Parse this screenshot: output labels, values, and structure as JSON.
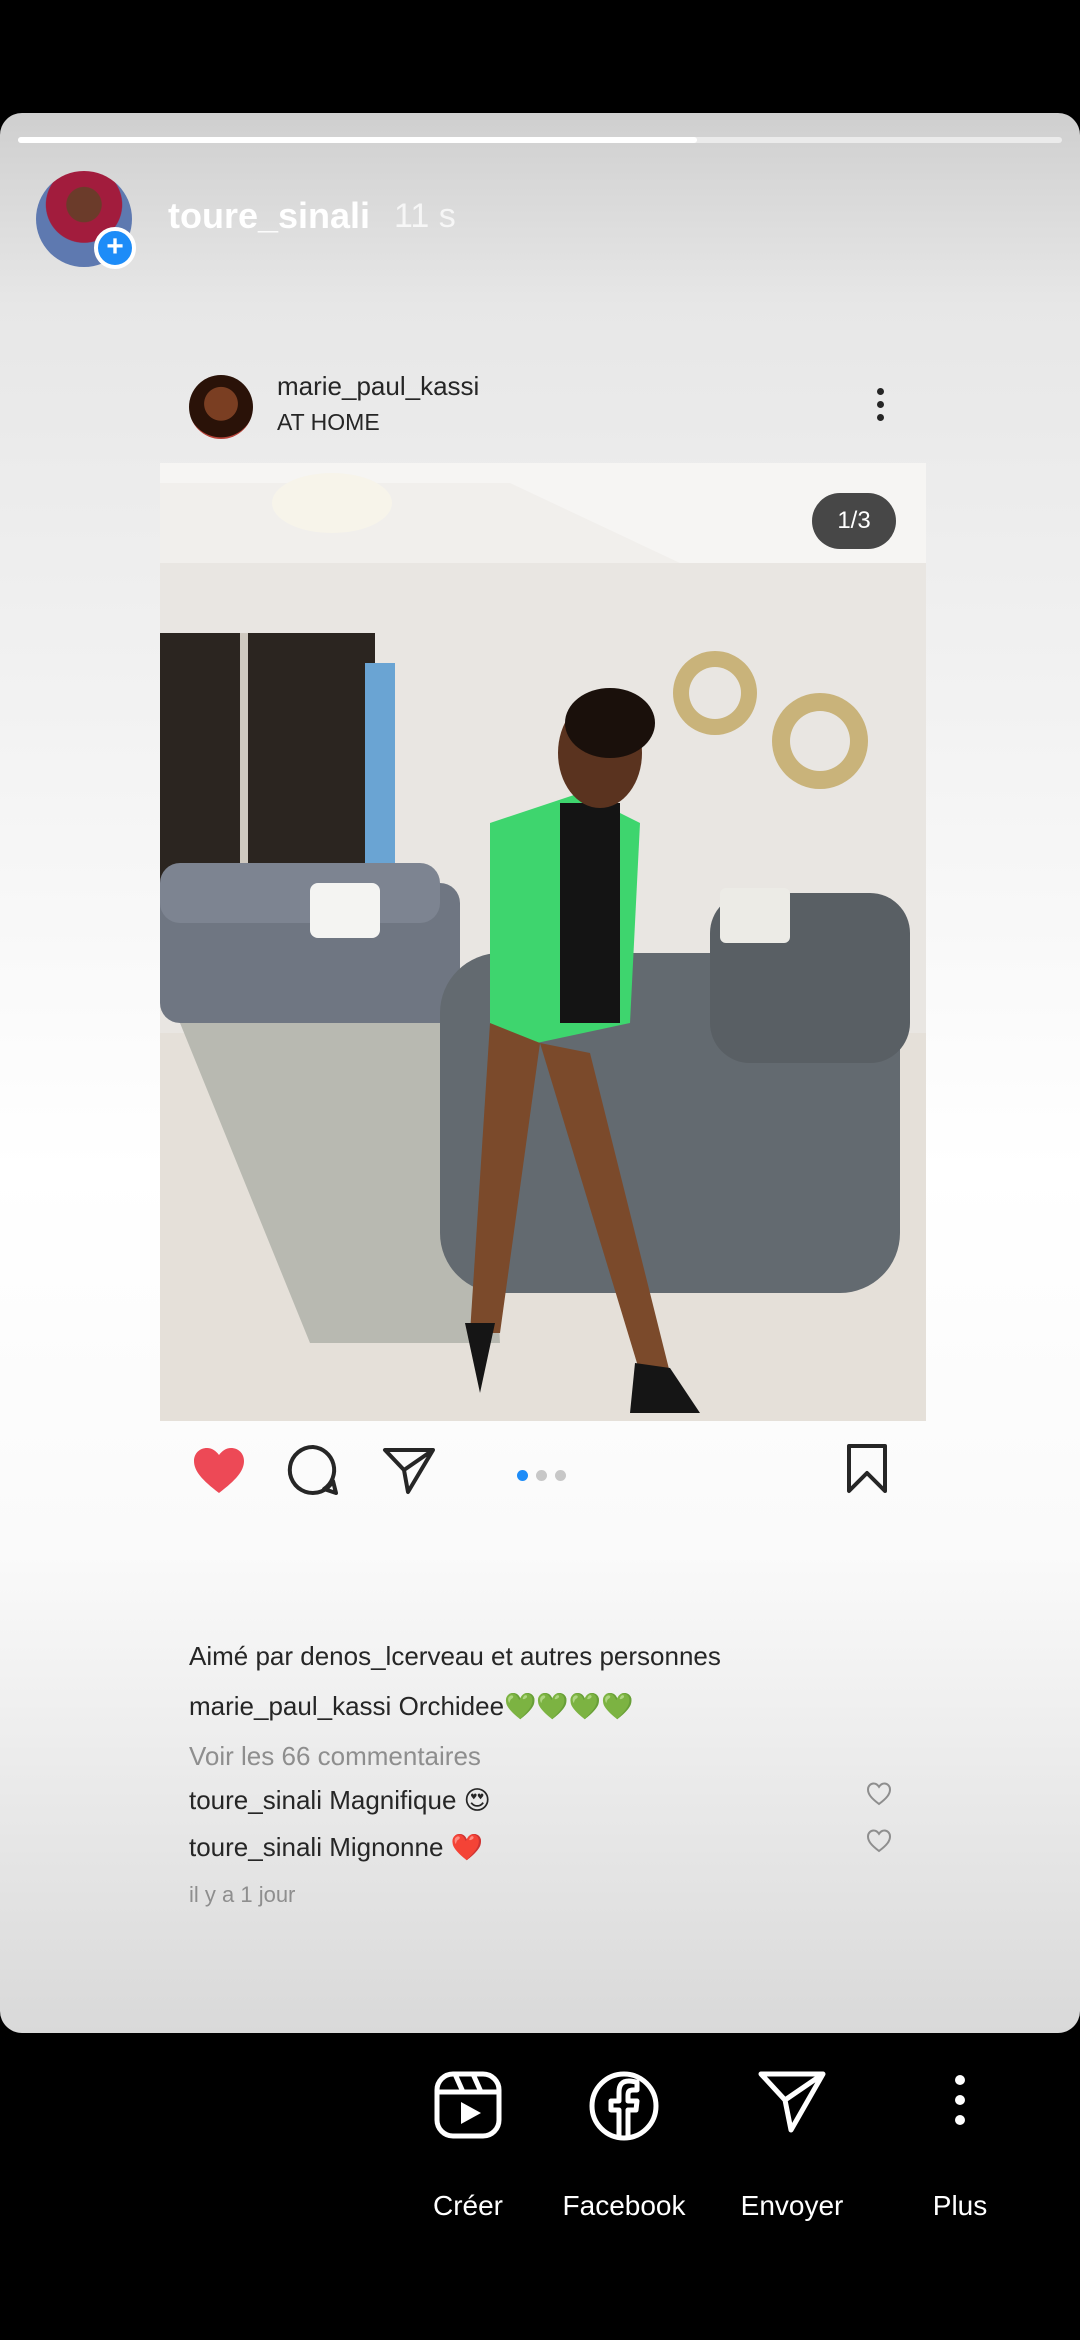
{
  "story": {
    "username": "toure_sinali",
    "time": "11 s",
    "progress_fraction": 0.65
  },
  "post": {
    "username": "marie_paul_kassi",
    "location": "AT HOME",
    "page_indicator": "1/3",
    "carousel_pages": 3,
    "carousel_active": 1,
    "likes_text": "Aimé par denos_lcerveau et autres personnes",
    "caption_user": "marie_paul_kassi",
    "caption_text": "Orchidee💚💚💚💚",
    "view_comments": "Voir les 66 commentaires",
    "comments": [
      {
        "user": "toure_sinali",
        "text": "Magnifique 😍"
      },
      {
        "user": "toure_sinali",
        "text": "Mignonne ❤️"
      }
    ],
    "date": "il y a 1 jour",
    "liked": true
  },
  "bottom_bar": {
    "items": [
      {
        "label": "Créer",
        "icon": "reels-icon"
      },
      {
        "label": "Facebook",
        "icon": "facebook-icon"
      },
      {
        "label": "Envoyer",
        "icon": "send-icon"
      },
      {
        "label": "Plus",
        "icon": "more-vertical-icon"
      }
    ]
  },
  "colors": {
    "like_red": "#ed4956",
    "accent_blue": "#1d8cf8"
  }
}
